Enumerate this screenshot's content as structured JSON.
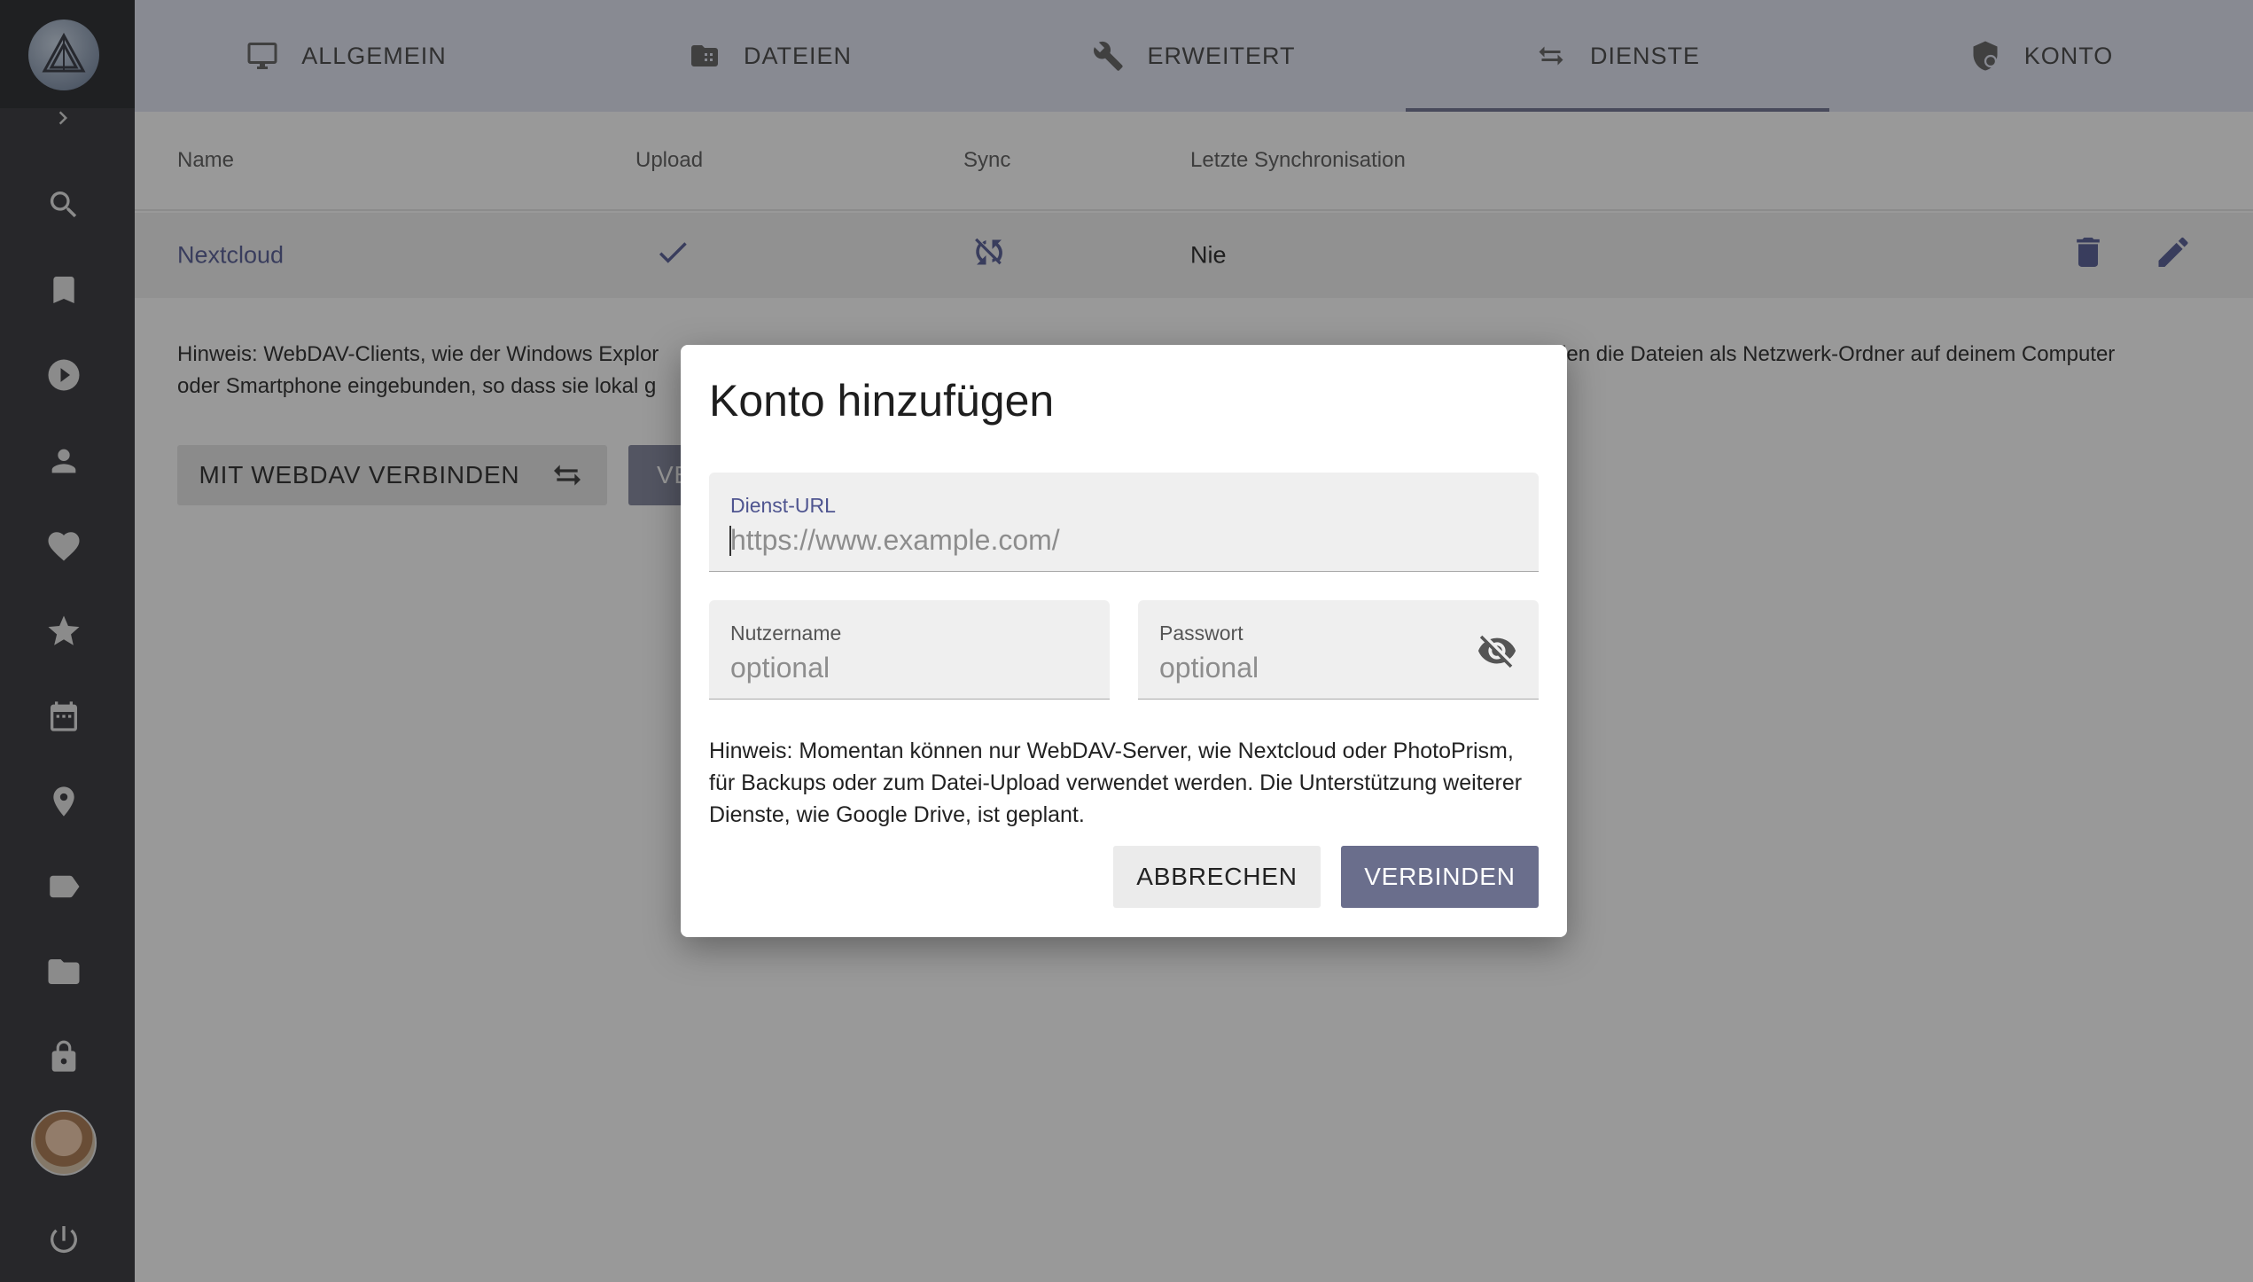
{
  "tabs": [
    {
      "label": "ALLGEMEIN",
      "icon": "monitor-icon"
    },
    {
      "label": "DATEIEN",
      "icon": "film-folder-icon"
    },
    {
      "label": "ERWEITERT",
      "icon": "wrench-icon"
    },
    {
      "label": "DIENSTE",
      "icon": "sync-arrows-icon",
      "active": true
    },
    {
      "label": "KONTO",
      "icon": "shield-account-icon"
    }
  ],
  "table": {
    "headers": [
      "Name",
      "Upload",
      "Sync",
      "Letzte Synchronisation"
    ],
    "rows": [
      {
        "name": "Nextcloud",
        "upload": "check-icon",
        "sync": "sync-off-icon",
        "last_sync": "Nie"
      }
    ]
  },
  "hint_main": "Hinweis: WebDAV-Clients, wie der Windows Explor rden die Dateien als Netzwerk-Ordner auf deinem Computer oder Smartphone eingebunden, so dass sie lokal g",
  "hint_main_line1_left": "Hinweis: WebDAV-Clients, wie der Windows Explor",
  "hint_main_line1_right": "rden die Dateien als Netzwerk-Ordner auf deinem Computer",
  "hint_main_line2": "oder Smartphone eingebunden, so dass sie lokal g",
  "buttons": {
    "webdav": "MIT WEBDAV VERBINDEN",
    "ve": "VE"
  },
  "sidebar": {
    "icons": [
      "search-icon",
      "bookmark-icon",
      "play-icon",
      "person-icon",
      "heart-icon",
      "star-icon",
      "calendar-icon",
      "map-pin-icon",
      "label-icon",
      "folder-icon",
      "lock-icon",
      "power-icon"
    ]
  },
  "dialog": {
    "title": "Konto hinzufügen",
    "url_label": "Dienst-URL",
    "url_placeholder": "https://www.example.com/",
    "user_label": "Nutzername",
    "user_placeholder": "optional",
    "pass_label": "Passwort",
    "pass_placeholder": "optional",
    "hint": "Hinweis: Momentan können nur WebDAV-Server, wie Nextcloud oder PhotoPrism, für Backups oder zum Datei-Upload verwendet werden. Die Unterstützung weiter­er Dienste, wie Google Drive, ist geplant.",
    "cancel": "ABBRECHEN",
    "connect": "VERBINDEN"
  },
  "colors": {
    "accent": "#6a6e8c",
    "sidebar": "#2d2e33",
    "tabs_bg": "#dfe3f3",
    "link": "#4f5590"
  }
}
